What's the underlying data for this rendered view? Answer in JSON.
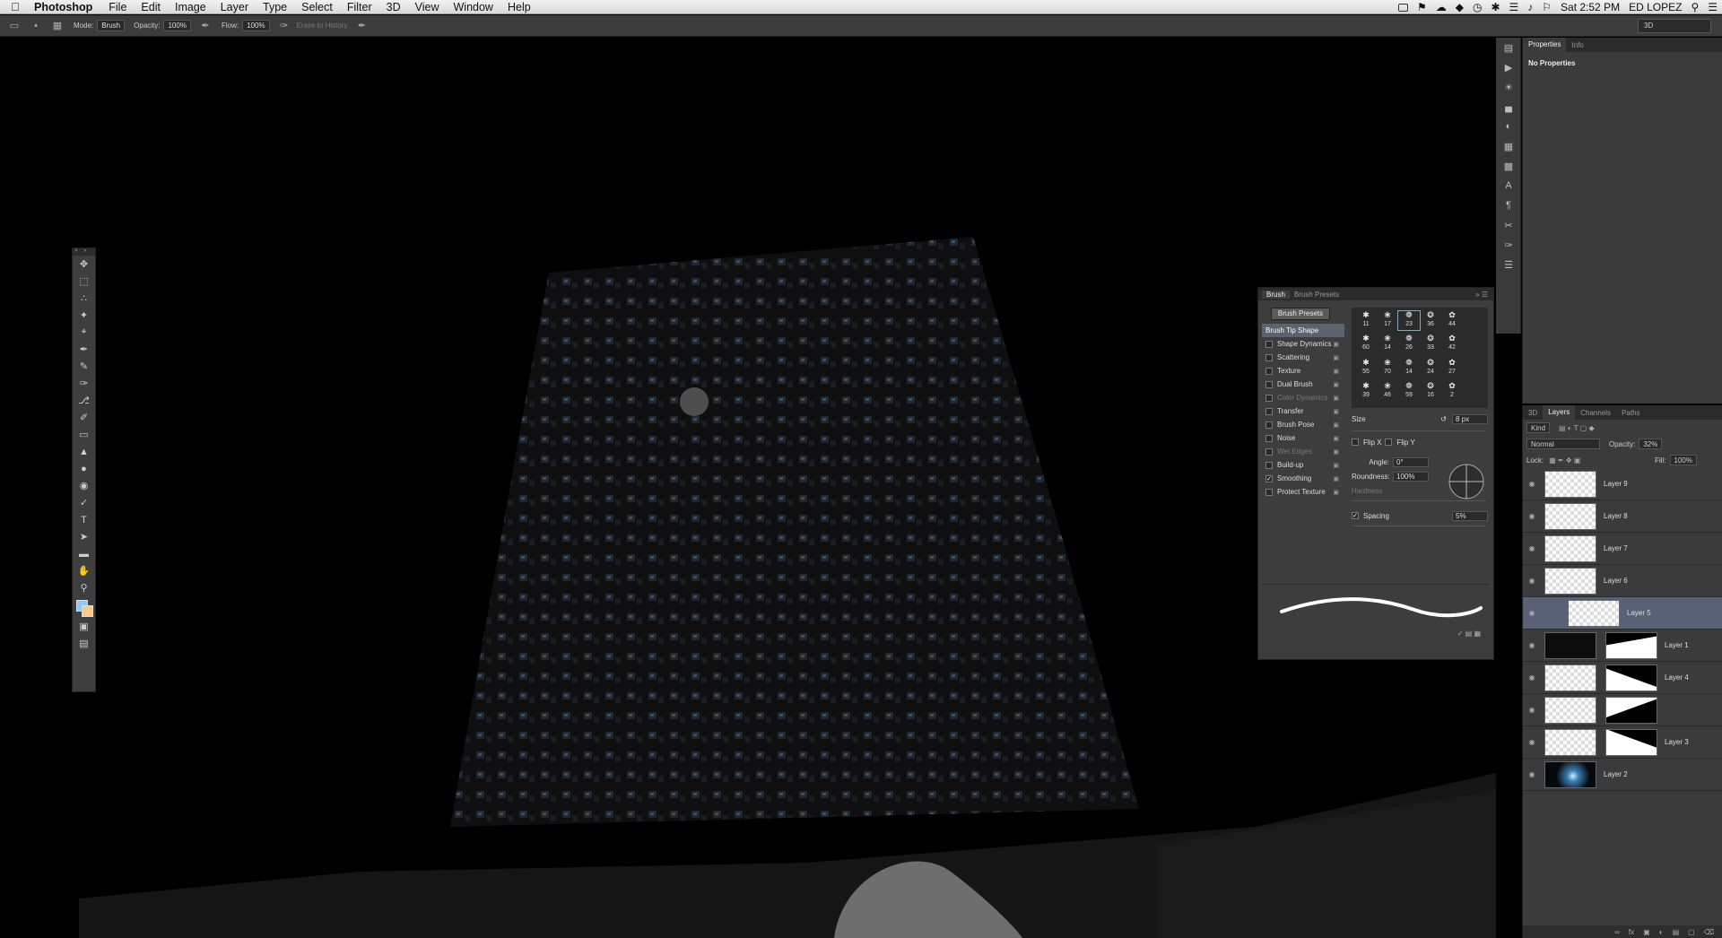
{
  "menubar": {
    "app": "Photoshop",
    "items": [
      "File",
      "Edit",
      "Image",
      "Layer",
      "Type",
      "Select",
      "Filter",
      "3D",
      "View",
      "Window",
      "Help"
    ],
    "clock": "Sat 2:52 PM",
    "user": "ED LOPEZ"
  },
  "options": {
    "mode_label": "Mode:",
    "mode_value": "Brush",
    "opacity_label": "Opacity:",
    "opacity_value": "100%",
    "flow_label": "Flow:",
    "flow_value": "100%",
    "erase_history": "Erase to History",
    "workspace": "3D"
  },
  "brush_panel": {
    "tabs": [
      "Brush",
      "Brush Presets"
    ],
    "presets_button": "Brush Presets",
    "options": [
      {
        "label": "Brush Tip Shape",
        "checked": false,
        "dim": false,
        "selected": true
      },
      {
        "label": "Shape Dynamics",
        "checked": false,
        "dim": false
      },
      {
        "label": "Scattering",
        "checked": false,
        "dim": false
      },
      {
        "label": "Texture",
        "checked": false,
        "dim": false
      },
      {
        "label": "Dual Brush",
        "checked": false,
        "dim": false
      },
      {
        "label": "Color Dynamics",
        "checked": false,
        "dim": true
      },
      {
        "label": "Transfer",
        "checked": false,
        "dim": false
      },
      {
        "label": "Brush Pose",
        "checked": false,
        "dim": false
      },
      {
        "label": "Noise",
        "checked": false,
        "dim": false
      },
      {
        "label": "Wet Edges",
        "checked": false,
        "dim": true
      },
      {
        "label": "Build-up",
        "checked": false,
        "dim": false
      },
      {
        "label": "Smoothing",
        "checked": true,
        "dim": false
      },
      {
        "label": "Protect Texture",
        "checked": false,
        "dim": false
      }
    ],
    "tip_sizes": [
      "11",
      "17",
      "23",
      "36",
      "44",
      "60",
      "14",
      "26",
      "33",
      "42",
      "55",
      "70",
      "14",
      "24",
      "27",
      "39",
      "46",
      "59",
      "16",
      "2"
    ],
    "size_label": "Size",
    "size_value": "8 px",
    "flip_x": "Flip X",
    "flip_y": "Flip Y",
    "angle_label": "Angle:",
    "angle_value": "0°",
    "roundness_label": "Roundness:",
    "roundness_value": "100%",
    "hardness_label": "Hardness",
    "spacing_label": "Spacing",
    "spacing_value": "5%"
  },
  "properties": {
    "tabs": [
      "Properties",
      "Info"
    ],
    "body": "No Properties"
  },
  "layers": {
    "tabs": [
      "3D",
      "Layers",
      "Channels",
      "Paths"
    ],
    "kind": "Kind",
    "blend": "Normal",
    "opacity_label": "Opacity:",
    "opacity_value": "32%",
    "lock_label": "Lock:",
    "fill_label": "Fill:",
    "fill_value": "100%",
    "items": [
      {
        "name": "Layer 9"
      },
      {
        "name": "Layer 8"
      },
      {
        "name": "Layer 7"
      },
      {
        "name": "Layer 6"
      },
      {
        "name": "Layer 5"
      },
      {
        "name": "Layer 1"
      },
      {
        "name": "Layer 4"
      },
      {
        "name": ""
      },
      {
        "name": "Layer 3"
      },
      {
        "name": "Layer 2"
      }
    ]
  }
}
